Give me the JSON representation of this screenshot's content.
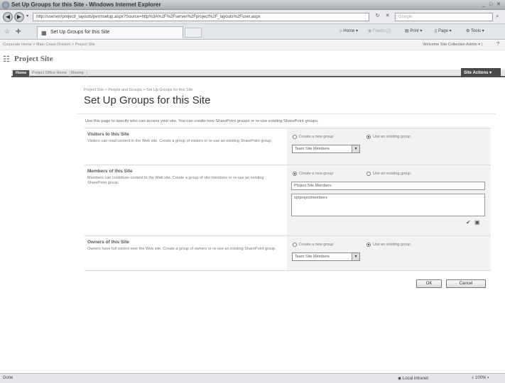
{
  "window": {
    "title": "Set Up Groups for this Site - Windows Internet Explorer"
  },
  "address": {
    "url": "http://sserver/project/_layouts/permsetup.aspx?Source=http%3A%2F%2Fserver%2Fproject%2F_layouts%2Fuser.aspx",
    "search_placeholder": "Google"
  },
  "tab": {
    "title": "Set Up Groups for this Site"
  },
  "commandbar": {
    "home": "Home",
    "feeds": "Feeds (J)",
    "print": "Print",
    "page": "Page",
    "tools": "Tools"
  },
  "global": {
    "breadcrumb": "Corporate Home > Main Coast Division > Project Site",
    "welcome": "Welcome Site Collection Admin"
  },
  "site": {
    "name": "Project Site"
  },
  "nav": {
    "tabs": [
      "Home",
      "Project Office Home",
      "Moving"
    ],
    "site_actions": "Site Actions"
  },
  "page": {
    "breadcrumb": "Project Site > People and Groups > Set Up Groups for this Site",
    "title": "Set Up Groups for this Site",
    "intro": "Use this page to specify who can access your site. You can create new SharePoint groups or re-use existing SharePoint groups."
  },
  "visitors": {
    "heading": "Visitors to this Site",
    "description": "Visitors can read content in the Web site. Create a group of visitors or re-use an existing SharePoint group.",
    "option_new": "Create a new group",
    "option_existing": "Use an existing group",
    "selected_group": "Team Site Members"
  },
  "members": {
    "heading": "Members of this Site",
    "description": "Members can contribute content to the Web site. Create a group of site members or re-use an existing SharePoint group.",
    "option_new": "Create a new group",
    "option_existing": "Use an existing group",
    "group_name": "Project Site Members",
    "users": "sp\\projectmembers"
  },
  "owners": {
    "heading": "Owners of this Site",
    "description": "Owners have full control over the Web site. Create a group of owners or re-use an existing SharePoint group.",
    "option_new": "Create a new group",
    "option_existing": "Use an existing group",
    "selected_group": "Team Site Members"
  },
  "buttons": {
    "ok": "OK",
    "cancel": "Cancel"
  },
  "status": {
    "left": "Done",
    "zone": "Local intranet",
    "zoom": "100%"
  }
}
